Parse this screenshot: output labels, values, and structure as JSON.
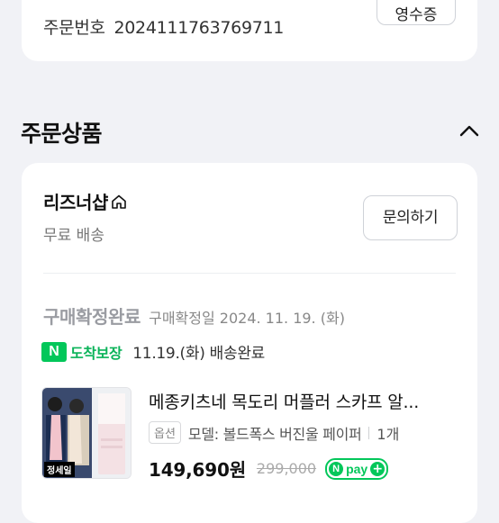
{
  "order": {
    "number_label": "주문번호",
    "number_value": "2024111763769711",
    "top_button_label": "영수증"
  },
  "section": {
    "title": "주문상품"
  },
  "store": {
    "name": "리즈너샵",
    "shipping": "무료 배송",
    "inquiry_button": "문의하기"
  },
  "status": {
    "label": "구매확정완료",
    "confirm_date": "구매확정일 2024. 11. 19. (화)"
  },
  "delivery": {
    "badge_letter": "N",
    "guarantee_label": "도착보장",
    "text": "11.19.(화) 배송완료"
  },
  "product": {
    "thumb_caption": "정세일",
    "title": "메종키츠네 목도리 머플러 스카프 알...",
    "option_chip": "옵션",
    "option_text": "모델: 볼드폭스 버진울 페이퍼",
    "quantity": "1개",
    "price": "149,690원",
    "original_price": "299,000",
    "npay_letter": "N",
    "npay_text": "pay",
    "npay_plus": "+"
  },
  "colors": {
    "naver_green": "#03c75a",
    "background": "#f1f2f6"
  },
  "icons": [
    "chevron-up-icon",
    "home-icon"
  ]
}
